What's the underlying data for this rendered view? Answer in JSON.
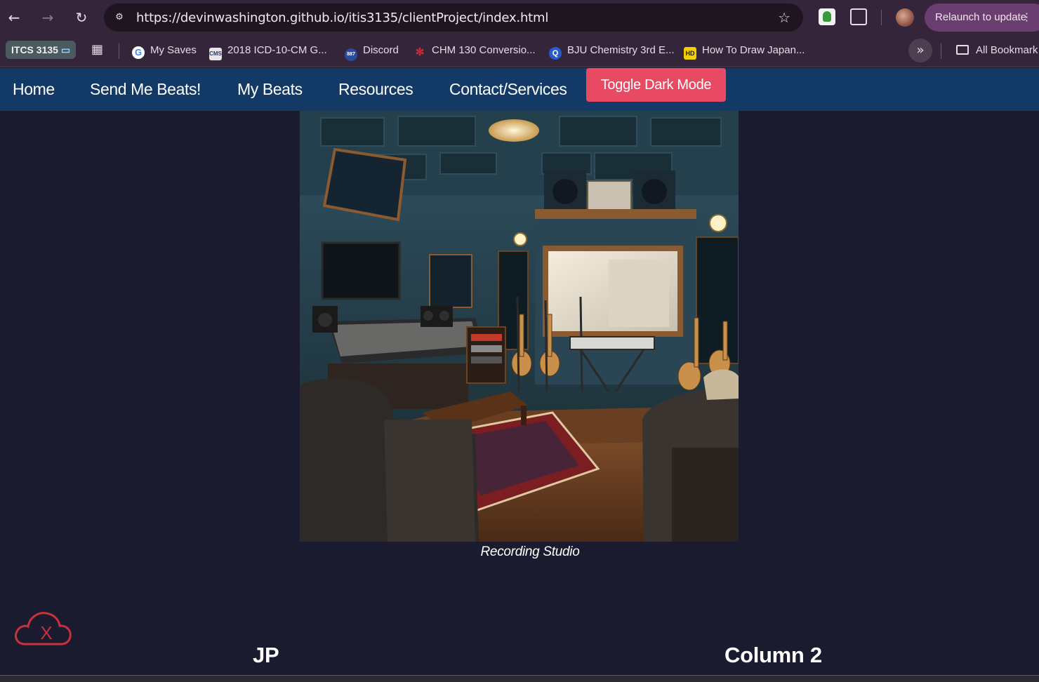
{
  "browser": {
    "url": "https://devinwashington.github.io/itis3135/clientProject/index.html",
    "relaunch_label": "Relaunch to update",
    "bookmarks": {
      "group_label": "ITCS 3135",
      "items": [
        {
          "label": "My Saves",
          "icon": "google-icon"
        },
        {
          "label": "2018 ICD-10-CM G...",
          "icon": "cms-icon"
        },
        {
          "label": "Discord",
          "icon": "discord-icon"
        },
        {
          "label": "CHM 130 Conversio...",
          "icon": "chm-icon"
        },
        {
          "label": "BJU Chemistry 3rd E...",
          "icon": "bju-icon"
        },
        {
          "label": "How To Draw Japan...",
          "icon": "hd-icon"
        }
      ],
      "all_bookmarks_label": "All Bookmark"
    }
  },
  "nav": {
    "items": [
      {
        "label": "Home"
      },
      {
        "label": "Send Me Beats!"
      },
      {
        "label": "My Beats"
      },
      {
        "label": "Resources"
      },
      {
        "label": "Contact/Services"
      }
    ],
    "toggle_label": "Toggle Dark Mode"
  },
  "hero": {
    "caption": "Recording Studio"
  },
  "columns": [
    {
      "heading": "JP"
    },
    {
      "heading": "Column 2"
    }
  ],
  "colors": {
    "page_background": "#1a1b2e",
    "nav_background": "#133a66",
    "toggle_button": "#e84a63",
    "error_cloud": "#c8323a"
  }
}
